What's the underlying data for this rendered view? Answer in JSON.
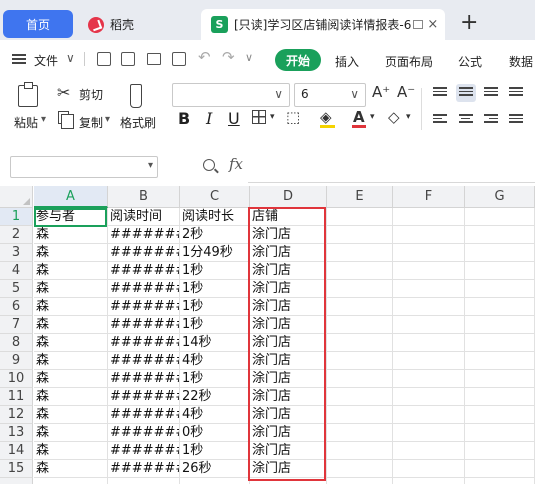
{
  "tabs": {
    "home": "首页",
    "docer": "稻壳",
    "doc_title": "[只读]学习区店铺阅读详情报表-6",
    "close": "×",
    "add": "+"
  },
  "menu": {
    "file": "文件",
    "file_arrow": "∨",
    "start": "开始",
    "insert": "插入",
    "page_layout": "页面布局",
    "formula": "公式",
    "data": "数据"
  },
  "ribbon": {
    "paste": "粘贴",
    "cut": "剪切",
    "copy": "复制",
    "format_painter": "格式刷",
    "font_name": "",
    "font_size": "6",
    "bold": "B",
    "italic": "I",
    "underline": "U",
    "grow_font": "A⁺",
    "shrink_font": "A⁻"
  },
  "formula_bar": {
    "name_box": "",
    "fx": "fx",
    "content": ""
  },
  "sheet": {
    "columns": [
      "A",
      "B",
      "C",
      "D",
      "E",
      "F",
      "G"
    ],
    "rows": [
      {
        "num": "1",
        "cells": [
          "参与者",
          "阅读时间",
          "阅读时长",
          "店铺"
        ]
      },
      {
        "num": "2",
        "cells": [
          "森",
          "########",
          "2秒",
          "涂门店"
        ]
      },
      {
        "num": "3",
        "cells": [
          "森",
          "########",
          "1分49秒",
          "涂门店"
        ]
      },
      {
        "num": "4",
        "cells": [
          "森",
          "########",
          "1秒",
          "涂门店"
        ]
      },
      {
        "num": "5",
        "cells": [
          "森",
          "########",
          "1秒",
          "涂门店"
        ]
      },
      {
        "num": "6",
        "cells": [
          "森",
          "########",
          "1秒",
          "涂门店"
        ]
      },
      {
        "num": "7",
        "cells": [
          "森",
          "########",
          "1秒",
          "涂门店"
        ]
      },
      {
        "num": "8",
        "cells": [
          "森",
          "########",
          "14秒",
          "涂门店"
        ]
      },
      {
        "num": "9",
        "cells": [
          "森",
          "########",
          "4秒",
          "涂门店"
        ]
      },
      {
        "num": "10",
        "cells": [
          "森",
          "########",
          "1秒",
          "涂门店"
        ]
      },
      {
        "num": "11",
        "cells": [
          "森",
          "########",
          "22秒",
          "涂门店"
        ]
      },
      {
        "num": "12",
        "cells": [
          "森",
          "########",
          "4秒",
          "涂门店"
        ]
      },
      {
        "num": "13",
        "cells": [
          "森",
          "########",
          "0秒",
          "涂门店"
        ]
      },
      {
        "num": "14",
        "cells": [
          "森",
          "########",
          "1秒",
          "涂门店"
        ]
      },
      {
        "num": "15",
        "cells": [
          "森",
          "########",
          "26秒",
          "涂门店"
        ]
      }
    ],
    "active_cell": "A1",
    "highlight_column": "D",
    "highlight_color": "#e0353b",
    "accent_color": "#1aa05b"
  }
}
